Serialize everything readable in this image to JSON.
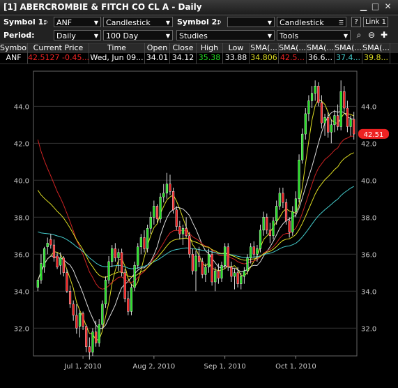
{
  "window": {
    "title": "[1] ABERCROMBIE & FITCH CO CL A - Daily"
  },
  "toolbar1": {
    "symbol1_label": "Symbol 1:",
    "symbol1_value": "ANF",
    "chart_type_1": "Candlestick",
    "symbol2_label": "Symbol 2:",
    "symbol2_value": "",
    "chart_type_2": "Candlestick",
    "help_label": "?",
    "link_label": "Link 1"
  },
  "toolbar2": {
    "period_label": "Period:",
    "period_value": "Daily",
    "range_value": "100 Day",
    "studies_label": "Studies",
    "tools_label": "Tools"
  },
  "quote": {
    "headers": [
      "Symbol",
      "Current Price",
      "Time",
      "Open",
      "Close",
      "High",
      "Low",
      "SMA(...",
      "SMA(...",
      "SMA(...",
      "SMA(...",
      "SMA(..."
    ],
    "symbol": "ANF",
    "price": "42.5127",
    "change": "-0.45...",
    "time": "Wed, Jun 09...",
    "open": "34.01",
    "close": "34.12",
    "high": "35.38",
    "low": "33.88",
    "sma1": "34.806",
    "sma2": "42.5...",
    "sma3": "36.6...",
    "sma4": "37.4...",
    "sma5": "39.8..."
  },
  "colors": {
    "up": "#22dd22",
    "down": "#ee2222",
    "sma_yellow": "#dddd22",
    "sma_red": "#cc2222",
    "sma_cyan": "#44cccc",
    "sma_white": "#dddddd",
    "price_tag": "#ee2222"
  },
  "chart_data": {
    "type": "candlestick",
    "y_ticks": [
      "32.0",
      "34.0",
      "36.0",
      "38.0",
      "40.0",
      "42.0",
      "44.0"
    ],
    "x_ticks": [
      "Jul 1, 2010",
      "Aug 2, 2010",
      "Sep 1, 2010",
      "Oct 1, 2010"
    ],
    "ylim": [
      30.5,
      45.9
    ],
    "current_price_label": "42.51",
    "candles": [
      [
        34.2,
        34.6,
        34.0,
        34.6
      ],
      [
        34.6,
        36.0,
        34.4,
        35.5
      ],
      [
        35.3,
        36.4,
        35.0,
        36.3
      ],
      [
        36.4,
        36.9,
        36.0,
        36.6
      ],
      [
        36.8,
        37.1,
        36.3,
        36.5
      ],
      [
        36.5,
        36.8,
        35.6,
        35.8
      ],
      [
        35.9,
        36.1,
        35.2,
        35.3
      ],
      [
        35.4,
        36.1,
        34.9,
        35.8
      ],
      [
        35.8,
        35.9,
        34.8,
        35.0
      ],
      [
        35.0,
        35.2,
        33.9,
        34.0
      ],
      [
        34.0,
        34.3,
        33.1,
        33.3
      ],
      [
        33.3,
        33.5,
        32.4,
        32.7
      ],
      [
        32.7,
        33.3,
        31.7,
        32.0
      ],
      [
        32.1,
        33.0,
        31.5,
        32.8
      ],
      [
        32.8,
        32.9,
        31.9,
        32.1
      ],
      [
        32.1,
        32.2,
        30.7,
        31.0
      ],
      [
        31.0,
        31.5,
        30.3,
        30.7
      ],
      [
        30.7,
        32.0,
        30.5,
        31.8
      ],
      [
        31.8,
        32.4,
        31.0,
        31.2
      ],
      [
        31.2,
        32.5,
        31.0,
        32.2
      ],
      [
        32.2,
        33.5,
        32.0,
        33.3
      ],
      [
        33.3,
        34.8,
        33.1,
        34.6
      ],
      [
        34.6,
        35.9,
        34.4,
        35.6
      ],
      [
        35.6,
        36.5,
        35.3,
        36.3
      ],
      [
        36.3,
        36.6,
        35.6,
        35.8
      ],
      [
        35.8,
        36.3,
        35.1,
        36.1
      ],
      [
        36.1,
        36.3,
        34.8,
        35.0
      ],
      [
        35.0,
        35.2,
        33.4,
        33.6
      ],
      [
        33.6,
        34.0,
        32.7,
        32.9
      ],
      [
        32.9,
        34.4,
        32.7,
        34.2
      ],
      [
        34.2,
        35.6,
        34.0,
        35.4
      ],
      [
        35.4,
        36.6,
        35.2,
        36.4
      ],
      [
        36.4,
        37.1,
        36.0,
        36.9
      ],
      [
        36.9,
        37.3,
        36.1,
        36.3
      ],
      [
        36.3,
        37.6,
        36.1,
        37.4
      ],
      [
        37.4,
        38.3,
        37.1,
        38.0
      ],
      [
        38.0,
        38.9,
        37.6,
        38.6
      ],
      [
        38.6,
        38.7,
        37.7,
        37.9
      ],
      [
        37.9,
        39.3,
        37.7,
        39.1
      ],
      [
        39.1,
        39.8,
        38.8,
        39.3
      ],
      [
        39.3,
        40.4,
        39.0,
        39.8
      ],
      [
        39.8,
        40.3,
        39.2,
        39.4
      ],
      [
        39.4,
        39.6,
        38.2,
        38.4
      ],
      [
        38.4,
        38.6,
        37.3,
        37.5
      ],
      [
        37.5,
        37.8,
        36.8,
        37.1
      ],
      [
        37.1,
        37.6,
        36.5,
        37.4
      ],
      [
        37.4,
        38.0,
        36.9,
        37.0
      ],
      [
        37.0,
        37.2,
        35.8,
        36.0
      ],
      [
        36.0,
        36.3,
        34.9,
        35.1
      ],
      [
        35.1,
        36.2,
        34.0,
        35.9
      ],
      [
        35.9,
        36.4,
        35.3,
        35.6
      ],
      [
        35.6,
        35.8,
        34.7,
        34.9
      ],
      [
        34.9,
        35.5,
        34.5,
        35.3
      ],
      [
        35.3,
        36.3,
        35.0,
        36.0
      ],
      [
        36.0,
        36.2,
        34.3,
        34.5
      ],
      [
        34.5,
        35.3,
        34.0,
        35.1
      ],
      [
        35.1,
        35.5,
        34.4,
        34.7
      ],
      [
        34.7,
        35.6,
        34.5,
        35.4
      ],
      [
        35.4,
        36.6,
        35.2,
        36.4
      ],
      [
        36.4,
        36.6,
        35.1,
        35.3
      ],
      [
        35.3,
        35.6,
        34.5,
        34.8
      ],
      [
        34.8,
        35.2,
        34.1,
        35.0
      ],
      [
        35.0,
        35.3,
        34.2,
        34.4
      ],
      [
        34.4,
        35.0,
        34.1,
        34.8
      ],
      [
        34.8,
        35.3,
        34.4,
        35.1
      ],
      [
        35.1,
        36.0,
        34.9,
        35.8
      ],
      [
        35.8,
        36.6,
        35.5,
        36.4
      ],
      [
        36.4,
        36.7,
        35.8,
        36.0
      ],
      [
        36.0,
        36.5,
        35.6,
        36.3
      ],
      [
        36.3,
        37.6,
        36.1,
        37.3
      ],
      [
        37.3,
        38.3,
        37.0,
        38.0
      ],
      [
        38.0,
        38.2,
        37.1,
        37.3
      ],
      [
        37.3,
        37.7,
        36.6,
        37.0
      ],
      [
        37.0,
        38.0,
        36.8,
        37.8
      ],
      [
        37.8,
        38.9,
        37.6,
        38.6
      ],
      [
        38.6,
        39.6,
        38.4,
        39.3
      ],
      [
        39.3,
        39.6,
        38.5,
        38.8
      ],
      [
        38.8,
        39.0,
        37.6,
        37.8
      ],
      [
        37.8,
        38.0,
        36.9,
        37.2
      ],
      [
        37.2,
        38.6,
        37.0,
        38.3
      ],
      [
        38.3,
        39.4,
        38.0,
        39.0
      ],
      [
        39.0,
        41.4,
        38.8,
        41.1
      ],
      [
        41.1,
        42.8,
        40.9,
        42.5
      ],
      [
        42.5,
        43.9,
        42.2,
        43.6
      ],
      [
        43.6,
        44.6,
        43.2,
        44.3
      ],
      [
        44.3,
        45.1,
        43.9,
        44.7
      ],
      [
        44.7,
        45.4,
        44.3,
        45.1
      ],
      [
        45.1,
        45.3,
        44.0,
        44.2
      ],
      [
        44.2,
        44.6,
        42.8,
        43.1
      ],
      [
        43.1,
        43.6,
        42.4,
        43.4
      ],
      [
        43.4,
        43.7,
        42.3,
        42.6
      ],
      [
        42.6,
        43.3,
        42.0,
        43.0
      ],
      [
        43.0,
        43.8,
        42.6,
        43.5
      ],
      [
        43.5,
        44.1,
        42.7,
        42.9
      ],
      [
        42.9,
        45.4,
        42.7,
        44.8
      ],
      [
        44.8,
        45.1,
        43.7,
        43.9
      ],
      [
        43.9,
        44.3,
        42.6,
        42.9
      ],
      [
        42.9,
        43.5,
        42.4,
        43.3
      ],
      [
        43.3,
        43.7,
        42.2,
        42.5
      ]
    ]
  }
}
